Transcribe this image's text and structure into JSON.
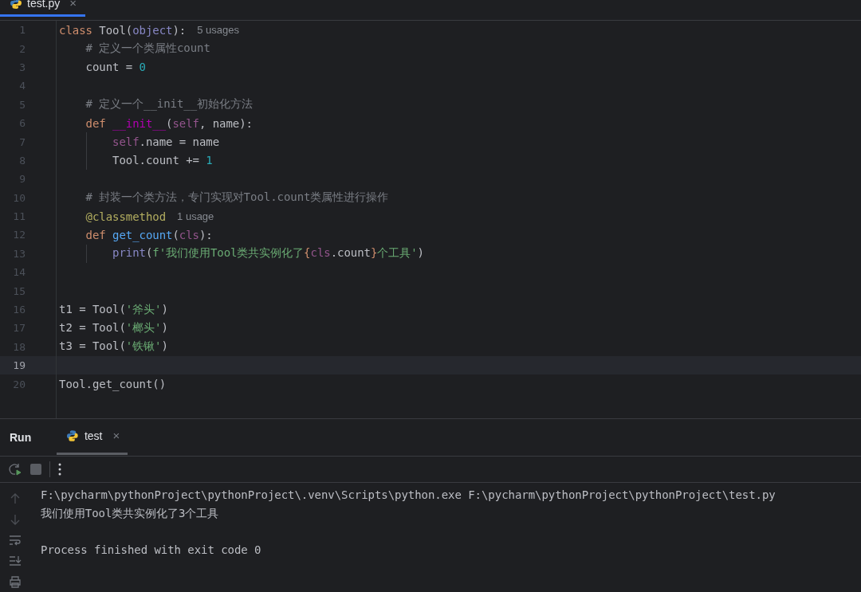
{
  "editor_tabs": [
    {
      "label": "test.py",
      "selected": true,
      "close": "×"
    }
  ],
  "code_lines": [
    {
      "number": "1",
      "current": false,
      "tokens": [
        {
          "text": "class",
          "kind": "keyword"
        },
        {
          "text": " Tool(",
          "kind": "plain"
        },
        {
          "text": "object",
          "kind": "builtin"
        },
        {
          "text": "):",
          "kind": "plain"
        },
        {
          "text": "5 usages",
          "kind": "hint"
        }
      ]
    },
    {
      "number": "2",
      "current": false,
      "tokens": [
        {
          "text": "    # 定义一个类属性count",
          "kind": "comment"
        }
      ]
    },
    {
      "number": "3",
      "current": false,
      "tokens": [
        {
          "text": "    count = ",
          "kind": "plain"
        },
        {
          "text": "0",
          "kind": "number"
        }
      ]
    },
    {
      "number": "4",
      "current": false
    },
    {
      "number": "5",
      "current": false,
      "tokens": [
        {
          "text": "    # 定义一个__init__初始化方法",
          "kind": "comment"
        }
      ]
    },
    {
      "number": "6",
      "current": false,
      "tokens": [
        {
          "text": "    def ",
          "kind": "keyword"
        },
        {
          "text": "__init__",
          "kind": "dunder"
        },
        {
          "text": "(",
          "kind": "plain"
        },
        {
          "text": "self",
          "kind": "self"
        },
        {
          "text": ", name):",
          "kind": "plain"
        }
      ]
    },
    {
      "number": "7",
      "current": false,
      "tokens": [
        {
          "text": "        self",
          "kind": "self"
        },
        {
          "text": ".name = name",
          "kind": "plain"
        }
      ]
    },
    {
      "number": "8",
      "current": false,
      "tokens": [
        {
          "text": "        Tool.count += ",
          "kind": "plain"
        },
        {
          "text": "1",
          "kind": "number"
        }
      ]
    },
    {
      "number": "9",
      "current": false
    },
    {
      "number": "10",
      "current": false,
      "tokens": [
        {
          "text": "    # 封装一个类方法，专门实现对Tool.count类属性进行操作",
          "kind": "comment"
        }
      ]
    },
    {
      "number": "11",
      "current": false,
      "tokens": [
        {
          "text": "    @classmethod",
          "kind": "decorator"
        },
        {
          "text": "1 usage",
          "kind": "hint"
        }
      ]
    },
    {
      "number": "12",
      "current": false,
      "tokens": [
        {
          "text": "    def ",
          "kind": "keyword"
        },
        {
          "text": "get_count",
          "kind": "function"
        },
        {
          "text": "(",
          "kind": "plain"
        },
        {
          "text": "cls",
          "kind": "self"
        },
        {
          "text": "):",
          "kind": "plain"
        }
      ]
    },
    {
      "number": "13",
      "current": false,
      "tokens": [
        {
          "text": "        print",
          "kind": "builtin"
        },
        {
          "text": "(",
          "kind": "plain"
        },
        {
          "text": "f'我们使用Tool类共实例化了",
          "kind": "string"
        },
        {
          "text": "{",
          "kind": "brace"
        },
        {
          "text": "cls",
          "kind": "self"
        },
        {
          "text": ".count",
          "kind": "plain"
        },
        {
          "text": "}",
          "kind": "brace"
        },
        {
          "text": "个工具'",
          "kind": "string"
        },
        {
          "text": ")",
          "kind": "plain"
        }
      ]
    },
    {
      "number": "14",
      "current": false
    },
    {
      "number": "15",
      "current": false
    },
    {
      "number": "16",
      "current": false,
      "tokens": [
        {
          "text": "t1 = Tool(",
          "kind": "plain"
        },
        {
          "text": "'斧头'",
          "kind": "string"
        },
        {
          "text": ")",
          "kind": "plain"
        }
      ]
    },
    {
      "number": "17",
      "current": false,
      "tokens": [
        {
          "text": "t2 = Tool(",
          "kind": "plain"
        },
        {
          "text": "'榔头'",
          "kind": "string"
        },
        {
          "text": ")",
          "kind": "plain"
        }
      ]
    },
    {
      "number": "18",
      "current": false,
      "tokens": [
        {
          "text": "t3 = Tool(",
          "kind": "plain"
        },
        {
          "text": "'铁锹'",
          "kind": "string"
        },
        {
          "text": ")",
          "kind": "plain"
        }
      ]
    },
    {
      "number": "19",
      "current": true
    },
    {
      "number": "20",
      "current": false,
      "tokens": [
        {
          "text": "Tool.get_count()",
          "kind": "plain"
        }
      ]
    }
  ],
  "run_panel": {
    "title": "Run",
    "tabs": [
      {
        "label": "test",
        "selected": true,
        "close": "×"
      }
    ],
    "output": [
      {
        "text": "F:\\pycharm\\pythonProject\\pythonProject\\.venv\\Scripts\\python.exe F:\\pycharm\\pythonProject\\pythonProject\\test.py"
      },
      {
        "text": "我们使用Tool类共实例化了3个工具"
      },
      {
        "text": "Process finished with exit code 0"
      }
    ]
  }
}
